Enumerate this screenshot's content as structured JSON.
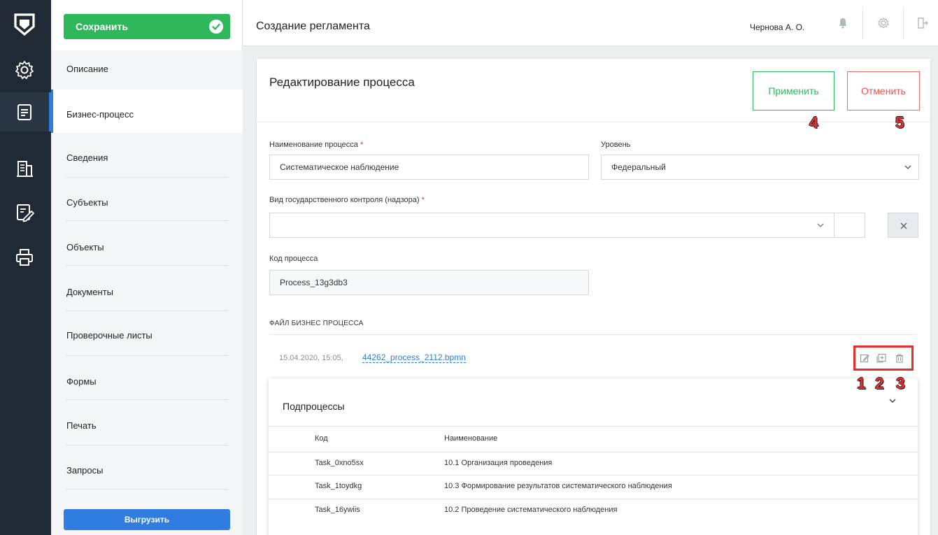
{
  "nav": {
    "save_label": "Сохранить",
    "items": [
      {
        "label": "Описание"
      },
      {
        "label": "Бизнес-процесс"
      },
      {
        "label": "Сведения"
      },
      {
        "label": "Субъекты"
      },
      {
        "label": "Объекты"
      },
      {
        "label": "Документы"
      },
      {
        "label": "Проверочные листы"
      },
      {
        "label": "Формы"
      },
      {
        "label": "Печать"
      },
      {
        "label": "Запросы"
      }
    ],
    "export_label": "Выгрузить",
    "rail_icons": [
      "settings-gear-icon",
      "document-list-icon",
      "building-icon",
      "edit-form-icon",
      "printer-icon"
    ]
  },
  "header": {
    "title": "Создание регламента",
    "user": "Чернова А. О.",
    "icons": [
      "bell-icon",
      "gear-icon",
      "logout-icon"
    ]
  },
  "card": {
    "title": "Редактирование процесса",
    "apply_label": "Применить",
    "cancel_label": "Отменить",
    "annotations": {
      "a1": "1",
      "a2": "2",
      "a3": "3",
      "a4": "4",
      "a5": "5"
    },
    "fields": {
      "process_name_label": "Наименование процесса",
      "process_name_value": "Систематическое наблюдение",
      "level_label": "Уровень",
      "level_value": "Федеральный",
      "control_type_label": "Вид государственного контроля (надзора)",
      "control_type_value": "",
      "process_code_label": "Код процесса",
      "process_code_value": "Process_13g3db3",
      "required_mark": "*"
    },
    "file_section": {
      "title": "ФАЙЛ БИЗНЕС ПРОЦЕССА",
      "date": "15.04.2020, 15:05,",
      "filename": "44262_process_2112.bpmn",
      "icons": [
        "edit-icon",
        "add-icon",
        "delete-icon"
      ]
    },
    "subprocesses": {
      "title": "Подпроцессы",
      "columns": [
        "Код",
        "Наименование"
      ],
      "rows": [
        {
          "code": "Task_0xno5sx",
          "name": "10.1 Организация проведения"
        },
        {
          "code": "Task_1toydkg",
          "name": "10.3 Формирование результатов систематического наблюдения"
        },
        {
          "code": "Task_16ywiis",
          "name": "10.2 Проведение систематического наблюдения"
        }
      ]
    }
  },
  "colors": {
    "rail": "#1f2a36",
    "accent_blue": "#2f7de1",
    "save_green": "#2fb85b",
    "cancel_red": "#f05050",
    "annotation_red": "#e23030"
  }
}
